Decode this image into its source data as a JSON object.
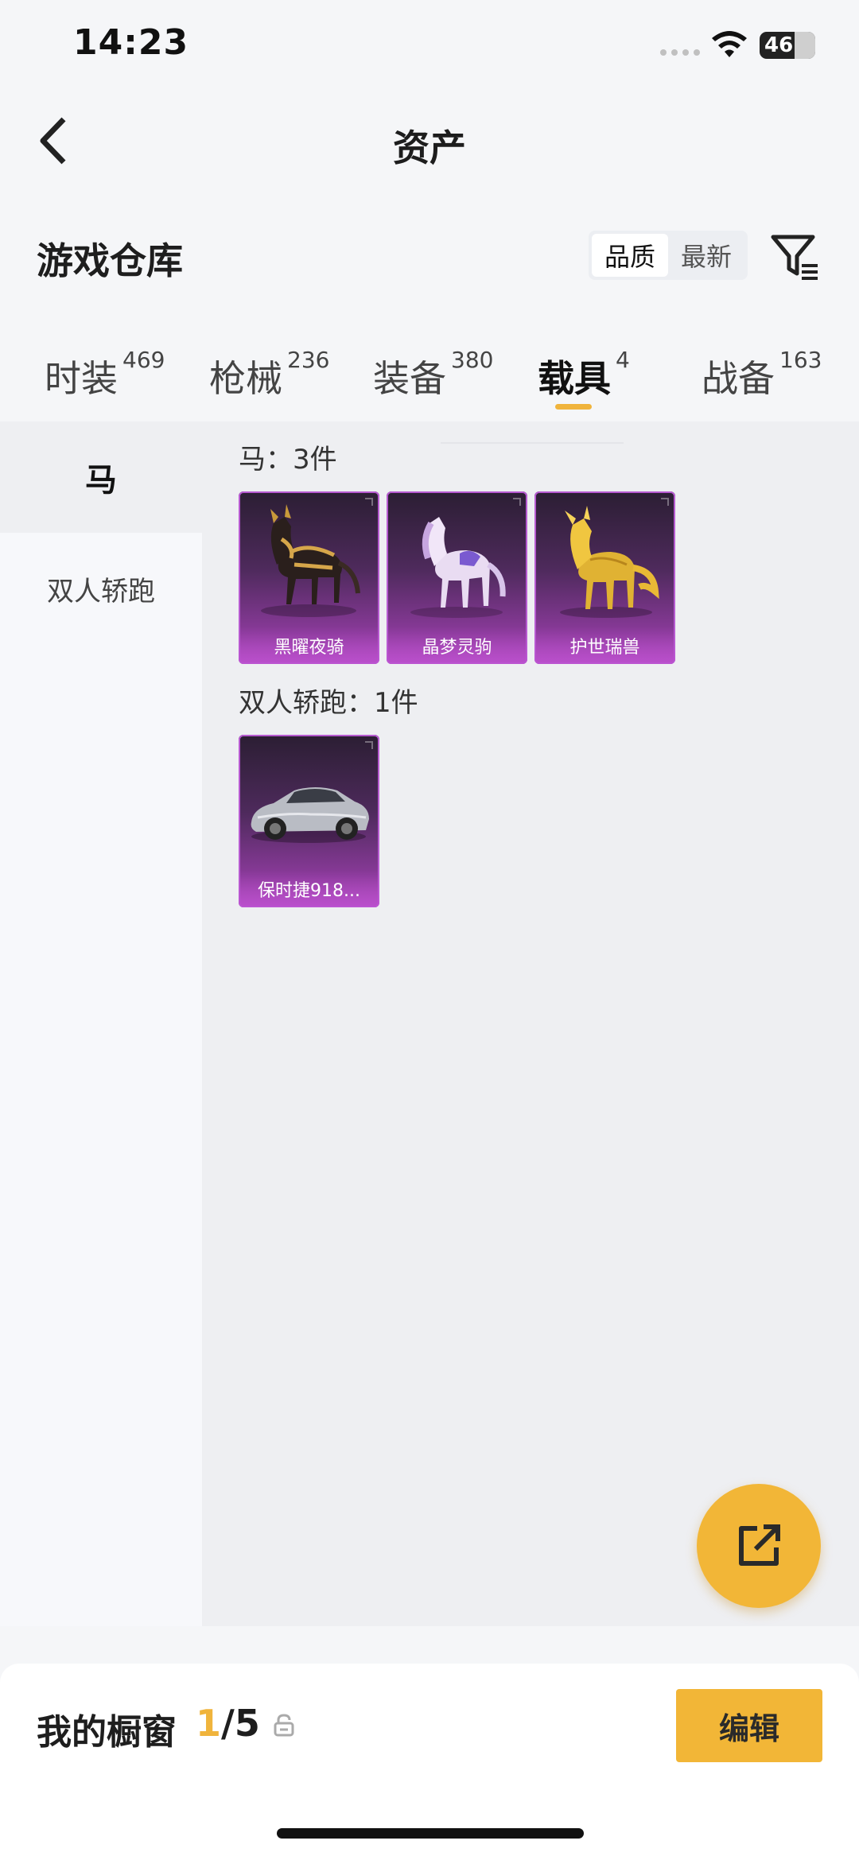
{
  "status_bar": {
    "time": "14:23",
    "battery": "46"
  },
  "header": {
    "title": "资产"
  },
  "section": {
    "title": "游戏仓库",
    "sort_options": [
      "品质",
      "最新"
    ],
    "sort_selected": "品质"
  },
  "tabs": [
    {
      "label": "时装",
      "count": "469",
      "active": false
    },
    {
      "label": "枪械",
      "count": "236",
      "active": false
    },
    {
      "label": "装备",
      "count": "380",
      "active": false
    },
    {
      "label": "载具",
      "count": "4",
      "active": true
    },
    {
      "label": "战备",
      "count": "163",
      "active": false
    }
  ],
  "categories": [
    {
      "label": "马",
      "active": true
    },
    {
      "label": "双人轿跑",
      "active": false
    }
  ],
  "groups": [
    {
      "label": "马：3件",
      "items": [
        {
          "name": "黑曜夜骑",
          "icon": "black-horse-icon"
        },
        {
          "name": "晶梦灵驹",
          "icon": "crystal-horse-icon"
        },
        {
          "name": "护世瑞兽",
          "icon": "golden-beast-icon"
        }
      ]
    },
    {
      "label": "双人轿跑：1件",
      "items": [
        {
          "name": "保时捷918...",
          "icon": "silver-sports-car-icon"
        }
      ]
    }
  ],
  "showcase": {
    "title": "我的橱窗",
    "current": "1",
    "total": "/5"
  },
  "edit_button": {
    "label": "编辑"
  },
  "colors": {
    "accent": "#f2b637",
    "card_purple": "#8a3a9a",
    "underline": "#f0b43c"
  }
}
